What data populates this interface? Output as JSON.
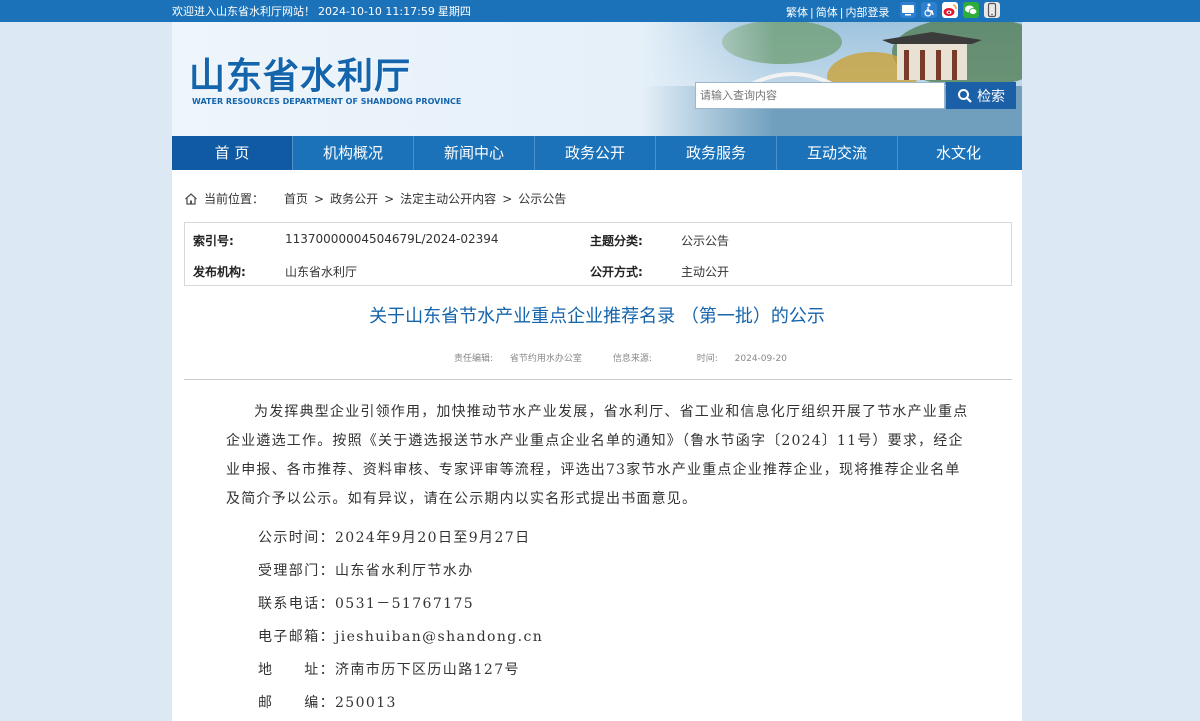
{
  "topbar": {
    "welcome": "欢迎进入山东省水利厅网站！",
    "datetime": "2024-10-10 11:17:59",
    "weekday": "星期四",
    "links": [
      "繁体",
      "简体",
      "内部登录"
    ],
    "icons": [
      "accessibility-icon",
      "wheelchair-icon",
      "weibo-icon",
      "wechat-icon",
      "mobile-icon"
    ]
  },
  "header": {
    "logo_cn": "山东省水利厅",
    "logo_en": "WATER RESOURCES DEPARTMENT OF SHANDONG PROVINCE",
    "search_placeholder": "请输入查询内容",
    "search_button": "检索"
  },
  "nav": {
    "items": [
      "首 页",
      "机构概况",
      "新闻中心",
      "政务公开",
      "政务服务",
      "互动交流",
      "水文化"
    ]
  },
  "breadcrumb": {
    "label": "当前位置：",
    "items": [
      "首页",
      "政务公开",
      "法定主动公开内容",
      "公示公告"
    ]
  },
  "meta": {
    "index_label": "索引号:",
    "index_value": "11370000004504679L/2024-02394",
    "topic_label": "主题分类:",
    "topic_value": "公示公告",
    "publisher_label": "发布机构:",
    "publisher_value": "山东省水利厅",
    "method_label": "公开方式:",
    "method_value": "主动公开"
  },
  "article": {
    "title": "关于山东省节水产业重点企业推荐名录 （第一批）的公示",
    "editor_label": "责任编辑:",
    "editor_value": "省节约用水办公室",
    "source_label": "信息来源:",
    "source_value": "",
    "time_label": "时间:",
    "time_value": "2024-09-20",
    "paragraph": "为发挥典型企业引领作用，加快推动节水产业发展，省水利厅、省工业和信息化厅组织开展了节水产业重点企业遴选工作。按照《关于遴选报送节水产业重点企业名单的通知》（鲁水节函字〔2024〕11号）要求，经企业申报、各市推荐、资料审核、专家评审等流程，评选出73家节水产业重点企业推荐企业，现将推荐企业名单及简介予以公示。如有异议，请在公示期内以实名形式提出书面意见。",
    "lines": [
      "公示时间：2024年9月20日至9月27日",
      "受理部门：山东省水利厅节水办",
      "联系电话：0531－51767175",
      "电子邮箱：jieshuiban@shandong.cn",
      "地　　址：济南市历下区历山路127号",
      "邮　　编：250013"
    ]
  },
  "colors": {
    "primary_blue": "#1b72b9",
    "title_blue": "#1565ad",
    "page_bg": "#dce8f4"
  }
}
